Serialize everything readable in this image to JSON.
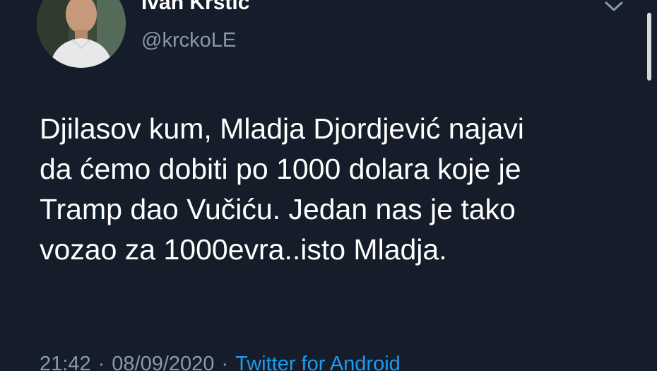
{
  "user": {
    "display_name": "Ivan Krstić",
    "handle": "@krckoLE"
  },
  "tweet": {
    "lines": [
      "Djilasov kum, Mladja Djordjević najavi",
      "da ćemo dobiti po 1000 dolara koje je",
      "Tramp dao Vučiću. Jedan nas je tako",
      "vozao za 1000evra..isto Mladja."
    ],
    "time": "21:42",
    "separator": "·",
    "date": "08/09/2020",
    "source": "Twitter for Android"
  },
  "colors": {
    "background": "#141d29",
    "secondary_text": "#8b98a5",
    "link": "#1d9bf0"
  },
  "icons": {
    "menu": "chevron-down-icon"
  }
}
